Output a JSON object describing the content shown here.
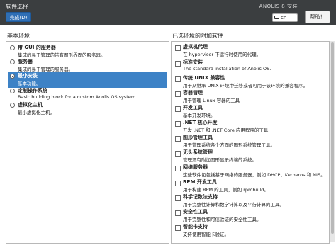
{
  "header": {
    "title": "软件选择",
    "done_label": "完成(D)",
    "install_label": "ANOLIS 8 安装",
    "keyboard_lang": "cn",
    "help_label": "帮助！"
  },
  "environments": {
    "title": "基本环境",
    "items": [
      {
        "name": "带 GUI 的服务器",
        "desc": "集成的易于管理的带有图形界面的服务器。",
        "selected": false
      },
      {
        "name": "服务器",
        "desc": "集成的易于管理的服务器。",
        "selected": false
      },
      {
        "name": "最小安装",
        "desc": "基本功能。",
        "selected": true
      },
      {
        "name": "定制操作系统",
        "desc": "Basic building block for a custom Anolis OS system.",
        "selected": false
      },
      {
        "name": "虚拟化主机",
        "desc": "最小虚拟化主机。",
        "selected": false
      }
    ]
  },
  "addons": {
    "title": "已选环境的附加软件",
    "items": [
      {
        "name": "虚拟机代理",
        "desc": "在 hypervisor 下运行时使用的代理。"
      },
      {
        "name": "标准安装",
        "desc": "The standard installation of Anolis OS."
      },
      {
        "name": "传统 UNIX 兼容性",
        "desc": "用于从继承 UNIX 环境中迁移或者可用于该环境的兼容程序。"
      },
      {
        "name": "容器管理",
        "desc": "用于管理 Linux 容器的工具"
      },
      {
        "name": "开发工具",
        "desc": "基本开发环境。"
      },
      {
        "name": ".NET 核心开发",
        "desc": "开发 .NET 和 .NET Core 应用程序的工具"
      },
      {
        "name": "图形管理工具",
        "desc": "用于管理系统各个方面的图形系统管理工具。"
      },
      {
        "name": "无头系统管理",
        "desc": "管理没有附加图形显示终端的系统。"
      },
      {
        "name": "网络服务器",
        "desc": "这些软件包包括基于网络的服务器，例如 DHCP、Kerberos 和 NIS。"
      },
      {
        "name": "RPM 开发工具",
        "desc": "用于构建 RPM 的工具，例如 rpmbuild。"
      },
      {
        "name": "科学记数法支持",
        "desc": "用于完整性计算和数学计算以及平行计算的工具。"
      },
      {
        "name": "安全性工具",
        "desc": "用于完整性和可信验证的安全性工具。"
      },
      {
        "name": "智能卡支持",
        "desc": "支持使用智能卡验证。"
      }
    ]
  }
}
